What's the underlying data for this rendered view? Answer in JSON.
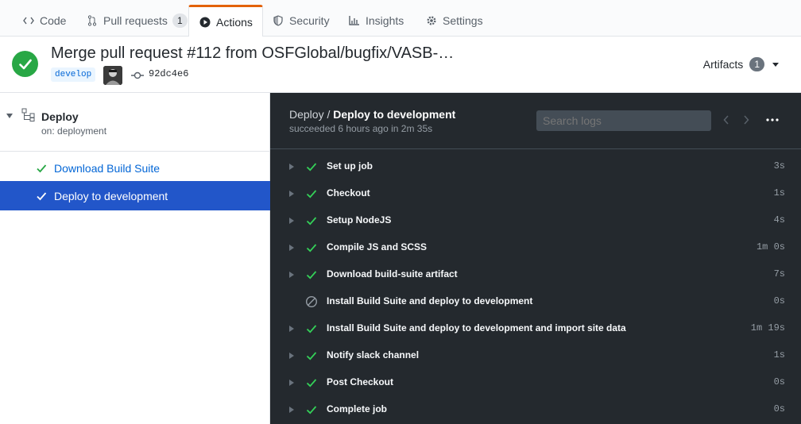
{
  "tabs": [
    {
      "label": "Code",
      "icon": "code-icon"
    },
    {
      "label": "Pull requests",
      "icon": "pull-request-icon",
      "count": "1"
    },
    {
      "label": "Actions",
      "icon": "play-icon",
      "active": true
    },
    {
      "label": "Security",
      "icon": "shield-icon"
    },
    {
      "label": "Insights",
      "icon": "graph-icon"
    },
    {
      "label": "Settings",
      "icon": "gear-icon"
    }
  ],
  "header": {
    "title": "Merge pull request #112 from OSFGlobal/bugfix/VASB-…",
    "branch": "develop",
    "sha": "92dc4e6",
    "artifacts_label": "Artifacts",
    "artifacts_count": "1",
    "status_color": "#28a745"
  },
  "sidebar": {
    "workflow_name": "Deploy",
    "workflow_trigger": "on: deployment",
    "jobs": [
      {
        "label": "Download Build Suite",
        "status": "success",
        "selected": false
      },
      {
        "label": "Deploy to development",
        "status": "success",
        "selected": true
      }
    ]
  },
  "logs": {
    "workflow": "Deploy",
    "separator": "/",
    "job": "Deploy to development",
    "summary": "succeeded 6 hours ago in 2m 35s",
    "search_placeholder": "Search logs",
    "steps": [
      {
        "label": "Set up job",
        "duration": "3s",
        "status": "success",
        "expandable": true
      },
      {
        "label": "Checkout",
        "duration": "1s",
        "status": "success",
        "expandable": true
      },
      {
        "label": "Setup NodeJS",
        "duration": "4s",
        "status": "success",
        "expandable": true
      },
      {
        "label": "Compile JS and SCSS",
        "duration": "1m 0s",
        "status": "success",
        "expandable": true
      },
      {
        "label": "Download build-suite artifact",
        "duration": "7s",
        "status": "success",
        "expandable": true
      },
      {
        "label": "Install Build Suite and deploy to development",
        "duration": "0s",
        "status": "skipped",
        "expandable": false
      },
      {
        "label": "Install Build Suite and deploy to development and import site data",
        "duration": "1m 19s",
        "status": "success",
        "expandable": true
      },
      {
        "label": "Notify slack channel",
        "duration": "1s",
        "status": "success",
        "expandable": true
      },
      {
        "label": "Post Checkout",
        "duration": "0s",
        "status": "success",
        "expandable": true
      },
      {
        "label": "Complete job",
        "duration": "0s",
        "status": "success",
        "expandable": true
      }
    ]
  },
  "colors": {
    "accent_tab": "#e36209",
    "success": "#28a745",
    "link": "#0366d6",
    "selected_job_bg": "#2256c9",
    "logs_bg": "#24292e"
  }
}
